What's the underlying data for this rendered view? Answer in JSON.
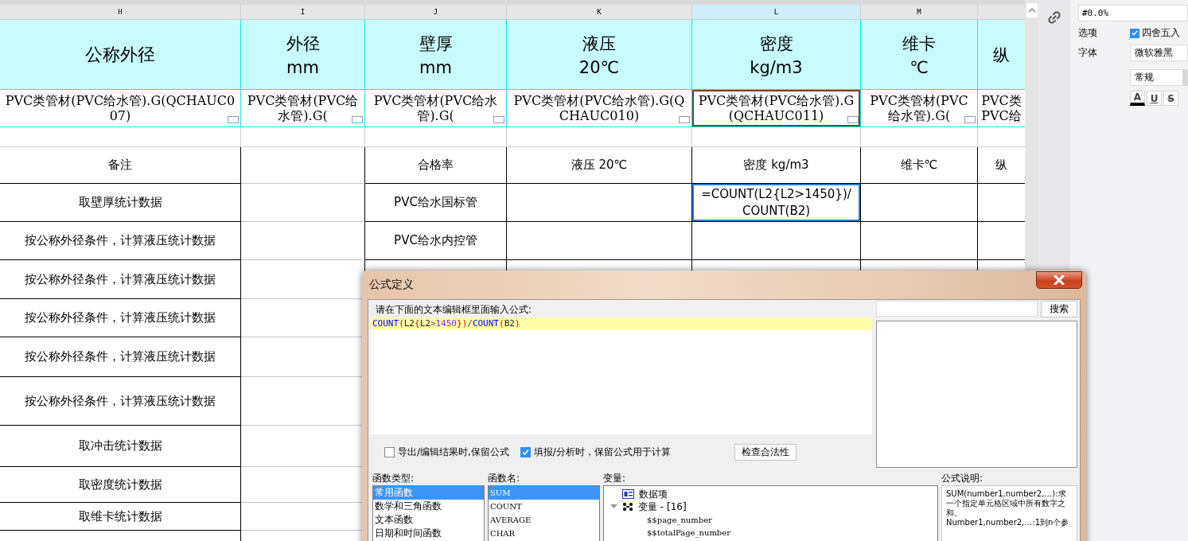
{
  "sheet": {
    "columns": [
      {
        "letter": "H",
        "selected": false
      },
      {
        "letter": "I",
        "selected": false
      },
      {
        "letter": "J",
        "selected": false
      },
      {
        "letter": "K",
        "selected": false
      },
      {
        "letter": "L",
        "selected": true
      },
      {
        "letter": "M",
        "selected": false
      },
      {
        "selected": false
      }
    ],
    "header_row": [
      [
        "公称外径"
      ],
      [
        "外径",
        "mm"
      ],
      [
        "壁厚",
        "mm"
      ],
      [
        "液压",
        "20℃"
      ],
      [
        "密度",
        "kg/m3"
      ],
      [
        "维卡",
        "℃"
      ],
      [
        "纵"
      ]
    ],
    "source_row": [
      {
        "text": "PVC类管材(PVC给水管).G(QCHAUC007)",
        "selected": false
      },
      {
        "text": "PVC类管材(PVC给水管).G(",
        "selected": false
      },
      {
        "text": "PVC类管材(PVC给水管).G(",
        "selected": false
      },
      {
        "text": "PVC类管材(PVC给水管).G(QCHAUC010)",
        "selected": false
      },
      {
        "text": "PVC类管材(PVC给水管).G(QCHAUC011)",
        "selected": true
      },
      {
        "text": "PVC类管材(PVC给水管).G(",
        "selected": false
      },
      {
        "text": "PVC类 PVC给",
        "selected": false
      }
    ],
    "rows": [
      {
        "cells": [
          {
            "text": "备注",
            "selected": false
          },
          null,
          {
            "text": "合格率",
            "selected": false
          },
          {
            "text": "液压 20℃",
            "selected": false
          },
          {
            "text": "密度 kg/m3",
            "selected": false
          },
          {
            "text": "维卡℃",
            "selected": false
          },
          {
            "text": "纵",
            "selected": false
          }
        ]
      },
      {
        "cells": [
          {
            "text": "取壁厚统计数据",
            "selected": false
          },
          null,
          {
            "text": "PVC给水国标管",
            "selected": false
          },
          null,
          {
            "text": "=COUNT(L2{L2>1450})/COUNT(B2)",
            "selected": true
          },
          null,
          null
        ]
      },
      {
        "cells": [
          {
            "text": "按公称外径条件，计算液压统计数据",
            "selected": false
          },
          null,
          {
            "text": "PVC给水内控管",
            "selected": false
          },
          null,
          null,
          null,
          null
        ]
      },
      {
        "cells": [
          {
            "text": "按公称外径条件，计算液压统计数据",
            "selected": false
          },
          null,
          null,
          null,
          null,
          null,
          null
        ]
      },
      {
        "cells": [
          {
            "text": "按公称外径条件，计算液压统计数据",
            "selected": false
          },
          null,
          null,
          null,
          null,
          null,
          null
        ]
      },
      {
        "cells": [
          {
            "text": "按公称外径条件，计算液压统计数据",
            "selected": false
          },
          null,
          null,
          null,
          null,
          null,
          null
        ]
      },
      {
        "cells": [
          {
            "text": "按公称外径条件，计算液压统计数据",
            "selected": false
          },
          null,
          null,
          null,
          null,
          null,
          null
        ]
      },
      {
        "cells": [
          {
            "text": "取冲击统计数据",
            "selected": false
          },
          null,
          null,
          null,
          null,
          null,
          null
        ]
      },
      {
        "cells": [
          {
            "text": "取密度统计数据",
            "selected": false
          },
          null,
          null,
          null,
          null,
          null,
          null
        ]
      },
      {
        "cells": [
          {
            "text": "取维卡统计数据",
            "selected": false
          },
          null,
          null,
          null,
          null,
          null,
          null
        ]
      }
    ]
  },
  "format_panel": {
    "format": "#0.0%",
    "options_label": "选项",
    "rounding": {
      "label": "四舍五入",
      "checked": true
    },
    "font_label": "字体",
    "font_family": "微软雅黑",
    "font_style": "常规",
    "style_buttons": [
      {
        "label": "A",
        "kind": "color"
      },
      {
        "label": "U",
        "kind": "underline"
      },
      {
        "label": "S",
        "kind": "strike"
      }
    ]
  },
  "dialog": {
    "title": "公式定义",
    "prompt": "请在下面的文本编辑框里面输入公式:",
    "formula": [
      {
        "text": "COUNT",
        "kind": "function"
      },
      {
        "text": "(",
        "kind": "bracket"
      },
      {
        "text": "L2",
        "kind": "ref"
      },
      {
        "text": "{",
        "kind": "bracket"
      },
      {
        "text": "L2",
        "kind": "ref"
      },
      {
        "text": ">",
        "kind": "operator"
      },
      {
        "text": "1450",
        "kind": "number"
      },
      {
        "text": "}",
        "kind": "bracket"
      },
      {
        "text": ")",
        "kind": "bracket"
      },
      {
        "text": "/",
        "kind": "operator"
      },
      {
        "text": "COUNT",
        "kind": "function"
      },
      {
        "text": "(",
        "kind": "bracket"
      },
      {
        "text": "B2",
        "kind": "ref"
      },
      {
        "text": ")",
        "kind": "bracket"
      }
    ],
    "search_button": "搜索",
    "keep_on_export": {
      "label": "导出/编辑结果时,保留公式",
      "checked": false
    },
    "keep_on_fill": {
      "label": "填报/分析时，保留公式用于计算",
      "checked": true
    },
    "check_button": "检查合法性",
    "function_types_label": "函数类型:",
    "function_types": [
      {
        "label": "常用函数",
        "selected": true
      },
      {
        "label": "数学和三角函数",
        "selected": false
      },
      {
        "label": "文本函数",
        "selected": false
      },
      {
        "label": "日期和时间函数",
        "selected": false
      }
    ],
    "function_names_label": "函数名:",
    "function_names": [
      {
        "label": "SUM",
        "selected": true
      },
      {
        "label": "COUNT",
        "selected": false
      },
      {
        "label": "AVERAGE",
        "selected": false
      },
      {
        "label": "CHAR",
        "selected": false
      }
    ],
    "variables_label": "变量:",
    "variables": [
      {
        "label": "数据项",
        "kind": "dataset"
      },
      {
        "label": "变量 - [16]",
        "kind": "group",
        "expanded": true,
        "children": [
          {
            "label": "$$page_number"
          },
          {
            "label": "$$totalPage_number"
          }
        ]
      }
    ],
    "description_label": "公式说明:",
    "description": [
      "SUM(number1,number2,…):求一个指定单元格区域中所有数字之和。",
      "Number1,number2,…:1到n个参"
    ]
  }
}
